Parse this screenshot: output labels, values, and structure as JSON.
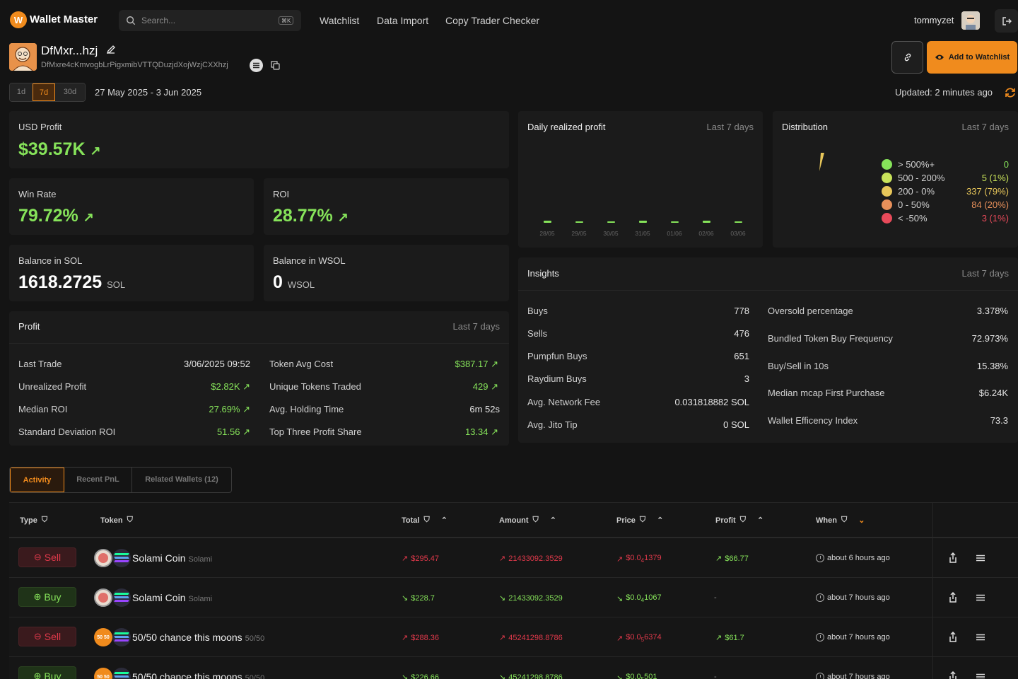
{
  "app": {
    "name": "Wallet Master",
    "logo_letter": "W"
  },
  "nav": {
    "search_placeholder": "Search...",
    "search_shortcut": "⌘K",
    "links": [
      "Watchlist",
      "Data Import",
      "Copy Trader Checker"
    ],
    "username": "tommyzet"
  },
  "wallet": {
    "name": "DfMxr...hzj",
    "address": "DfMxre4cKmvogbLrPigxmibVTTQDuzjdXojWzjCXXhzj",
    "add_watchlist": "Add to Watchlist"
  },
  "range": {
    "options": [
      "1d",
      "7d",
      "30d"
    ],
    "selected": "7d",
    "dates": "27 May 2025 - 3 Jun 2025",
    "updated": "Updated: 2 minutes ago"
  },
  "stats": {
    "usd_profit": {
      "label": "USD Profit",
      "value": "$39.57K"
    },
    "win_rate": {
      "label": "Win Rate",
      "value": "79.72%"
    },
    "roi": {
      "label": "ROI",
      "value": "28.77%"
    },
    "balance_sol": {
      "label": "Balance in SOL",
      "value": "1618.2725",
      "unit": "SOL"
    },
    "balance_wsol": {
      "label": "Balance in WSOL",
      "value": "0",
      "unit": "WSOL"
    }
  },
  "profit": {
    "title": "Profit",
    "period": "Last 7 days",
    "left": [
      {
        "k": "Last Trade",
        "v": "3/06/2025 09:52"
      },
      {
        "k": "Unrealized Profit",
        "v": "$2.82K"
      },
      {
        "k": "Median ROI",
        "v": "27.69%"
      },
      {
        "k": "Standard Deviation ROI",
        "v": "51.56"
      }
    ],
    "right": [
      {
        "k": "Token Avg Cost",
        "v": "$387.17"
      },
      {
        "k": "Unique Tokens Traded",
        "v": "429"
      },
      {
        "k": "Avg. Holding Time",
        "v": "6m 52s"
      },
      {
        "k": "Top Three Profit Share",
        "v": "13.34"
      }
    ]
  },
  "daily_profit": {
    "title": "Daily realized profit",
    "period": "Last 7 days"
  },
  "chart_data": {
    "type": "bar",
    "categories": [
      "28/05",
      "29/05",
      "30/05",
      "31/05",
      "01/06",
      "02/06",
      "03/06"
    ],
    "values": [
      0.3,
      0.25,
      0.2,
      0.35,
      0.25,
      0.3,
      0.15
    ],
    "title": "Daily realized profit",
    "xlabel": "",
    "ylabel": "",
    "grid": false
  },
  "distribution": {
    "title": "Distribution",
    "period": "Last 7 days",
    "rows": [
      {
        "label": "> 500%+",
        "value": "0",
        "color": "#86e35a"
      },
      {
        "label": "500 - 200%",
        "value": "5 (1%)",
        "color": "#c9e35a"
      },
      {
        "label": "200 - 0%",
        "value": "337 (79%)",
        "color": "#e8c75a"
      },
      {
        "label": "0 - 50%",
        "value": "84 (20%)",
        "color": "#e8905a"
      },
      {
        "label": "< -50%",
        "value": "3 (1%)",
        "color": "#e84a5a"
      }
    ]
  },
  "insights": {
    "title": "Insights",
    "period": "Last 7 days",
    "left": [
      {
        "k": "Buys",
        "v": "778"
      },
      {
        "k": "Sells",
        "v": "476"
      },
      {
        "k": "Pumpfun Buys",
        "v": "651"
      },
      {
        "k": "Raydium Buys",
        "v": "3"
      },
      {
        "k": "Avg. Network Fee",
        "v": "0.031818882 SOL"
      },
      {
        "k": "Avg. Jito Tip",
        "v": "0 SOL"
      }
    ],
    "right": [
      {
        "k": "Oversold percentage",
        "v": "3.378%"
      },
      {
        "k": "Bundled Token Buy Frequency",
        "v": "72.973%"
      },
      {
        "k": "Buy/Sell in 10s",
        "v": "15.38%"
      },
      {
        "k": "Median mcap First Purchase",
        "v": "$6.24K"
      },
      {
        "k": "Wallet Efficency Index",
        "v": "73.3"
      }
    ]
  },
  "tabs": [
    "Activity",
    "Recent PnL",
    "Related Wallets (12)"
  ],
  "table": {
    "headers": [
      "Type",
      "Token",
      "Total",
      "Amount",
      "Price",
      "Profit",
      "When"
    ],
    "rows": [
      {
        "type": "Sell",
        "token": "Solami Coin",
        "symbol": "Solami",
        "total": "$295.47",
        "amount": "21433092.3529",
        "price_pre": "$0.0",
        "price_sub": "4",
        "price_post": "1379",
        "profit": "$66.77",
        "when": "about 6 hours ago",
        "icon_text": ""
      },
      {
        "type": "Buy",
        "token": "Solami Coin",
        "symbol": "Solami",
        "total": "$228.7",
        "amount": "21433092.3529",
        "price_pre": "$0.0",
        "price_sub": "4",
        "price_post": "1067",
        "profit": "-",
        "when": "about 7 hours ago",
        "icon_text": ""
      },
      {
        "type": "Sell",
        "token": "50/50 chance this moons",
        "symbol": "50/50",
        "total": "$288.36",
        "amount": "45241298.8786",
        "price_pre": "$0.0",
        "price_sub": "5",
        "price_post": "6374",
        "profit": "$61.7",
        "when": "about 7 hours ago",
        "icon_text": "50 50"
      },
      {
        "type": "Buy",
        "token": "50/50 chance this moons",
        "symbol": "50/50",
        "total": "$226.66",
        "amount": "45241298.8786",
        "price_pre": "$0.0",
        "price_sub": "5",
        "price_post": "501",
        "profit": "-",
        "when": "about 7 hours ago",
        "icon_text": "50 50"
      }
    ]
  }
}
